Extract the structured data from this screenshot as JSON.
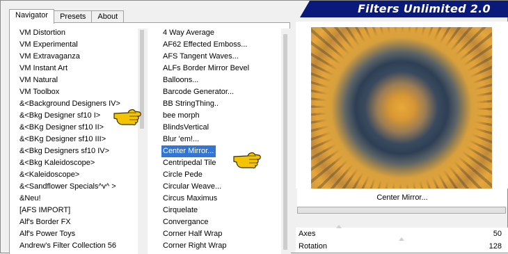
{
  "app": {
    "title": "Filters Unlimited 2.0"
  },
  "tabs": [
    {
      "label": "Navigator",
      "active": true
    },
    {
      "label": "Presets",
      "active": false
    },
    {
      "label": "About",
      "active": false
    }
  ],
  "categories": [
    "VM Distortion",
    "VM Experimental",
    "VM Extravaganza",
    "VM Instant Art",
    "VM Natural",
    "VM Toolbox",
    "&<Background Designers IV>",
    "&<Bkg Designer sf10 I>",
    "&<BKg Designer sf10 II>",
    "&<BKg Designer sf10 III>",
    "&<Bkg Designers sf10 IV>",
    "&<Bkg Kaleidoscope>",
    "&<Kaleidoscope>",
    "&<Sandflower Specials^v^ >",
    "&Neu!",
    "[AFS IMPORT]",
    "Alf's Border FX",
    "Alf's Power Toys",
    "Andrew's Filter Collection 56"
  ],
  "filters": [
    "4 Way Average",
    "AF62 Effected Emboss...",
    "AFS Tangent Waves...",
    "ALFs Border Mirror Bevel",
    "Balloons...",
    "Barcode Generator...",
    "BB StringThing..",
    "bee morph",
    "BlindsVertical",
    "Blur 'em!...",
    "Center Mirror...",
    "Centripedal Tile",
    "Circle Pede",
    "Circular Weave...",
    "Circus Maximus",
    "Cirquelate",
    "Convergance",
    "Corner Half Wrap",
    "Corner Right Wrap"
  ],
  "selected_filter_index": 10,
  "preview": {
    "filter_name": "Center Mirror..."
  },
  "params": [
    {
      "label": "Axes",
      "value": "50"
    },
    {
      "label": "Rotation",
      "value": "128"
    }
  ],
  "colors": {
    "banner": "#0a1a7a",
    "selection": "#3275d3",
    "hand": "#f5c400"
  }
}
